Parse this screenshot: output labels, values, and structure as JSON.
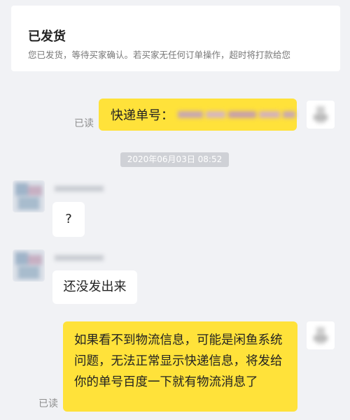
{
  "status_card": {
    "title": "已发货",
    "description": "您已发货，等待买家确认。若买家无任何订单操作，超时将打款给您"
  },
  "messages": {
    "tracking": {
      "read_status": "已读",
      "label": "快递单号："
    },
    "timestamp": "2020年06月03日 08:52",
    "buyer_msg_1": "?",
    "buyer_msg_2": "还没发出来",
    "seller_reply": {
      "read_status": "已读",
      "text": "如果看不到物流信息，可能是闲鱼系统问题，无法正常显示快递信息，将发给你的单号百度一下就有物流消息了"
    }
  },
  "colors": {
    "bubble_accent": "#ffe23a",
    "background": "#f1f2f5"
  }
}
